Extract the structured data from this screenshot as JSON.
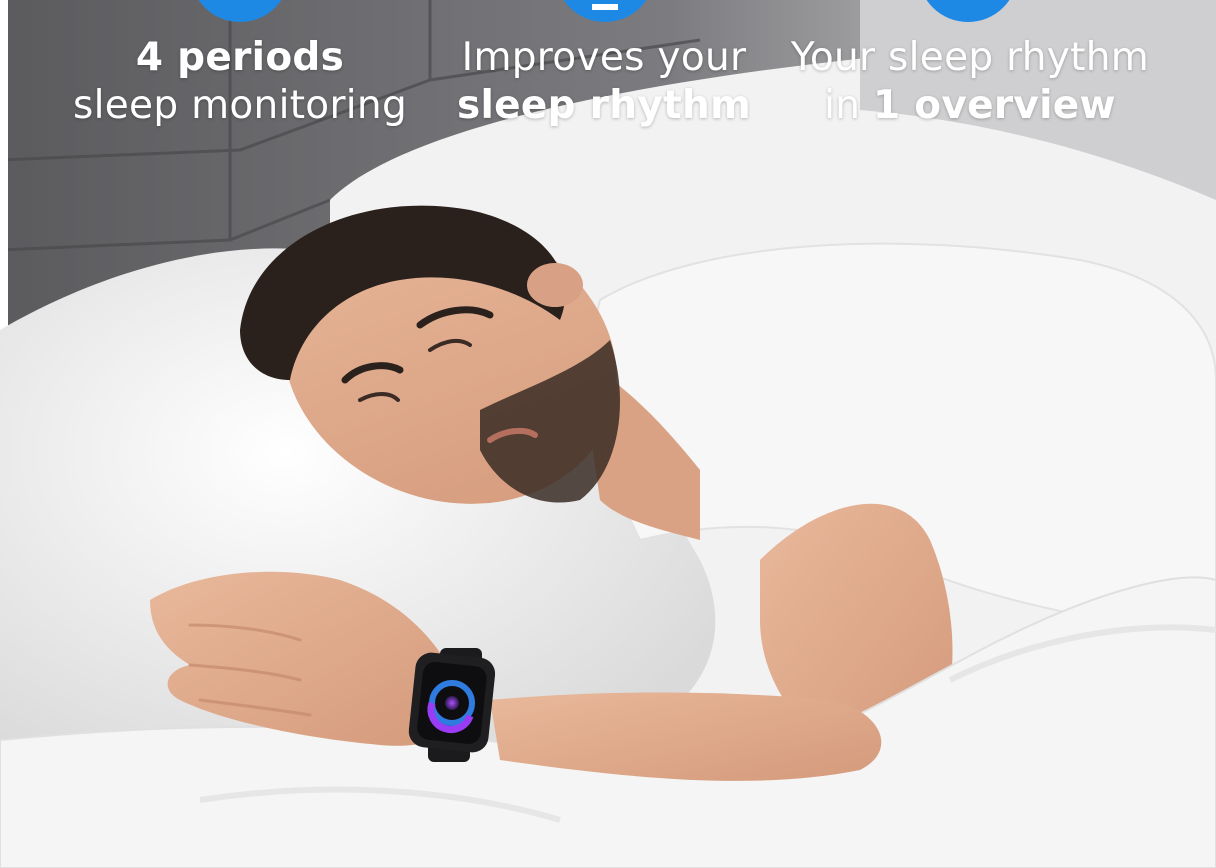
{
  "features": [
    {
      "icon": "blue-circle-icon",
      "line1_bold": "4 periods",
      "line2": "sleep monitoring"
    },
    {
      "icon": "blue-circle-icon",
      "line1": "Improves your",
      "line2_bold": "sleep rhythm"
    },
    {
      "icon": "blue-circle-icon",
      "line1": "Your sleep rhythm",
      "line2_prefix": "in ",
      "line2_bold": "1 overview"
    }
  ],
  "colors": {
    "accent_blue": "#1e88e5",
    "headboard": "#6f6f72",
    "sheets": "#f4f4f4",
    "watch_screen_purple": "#8b3cf0"
  }
}
